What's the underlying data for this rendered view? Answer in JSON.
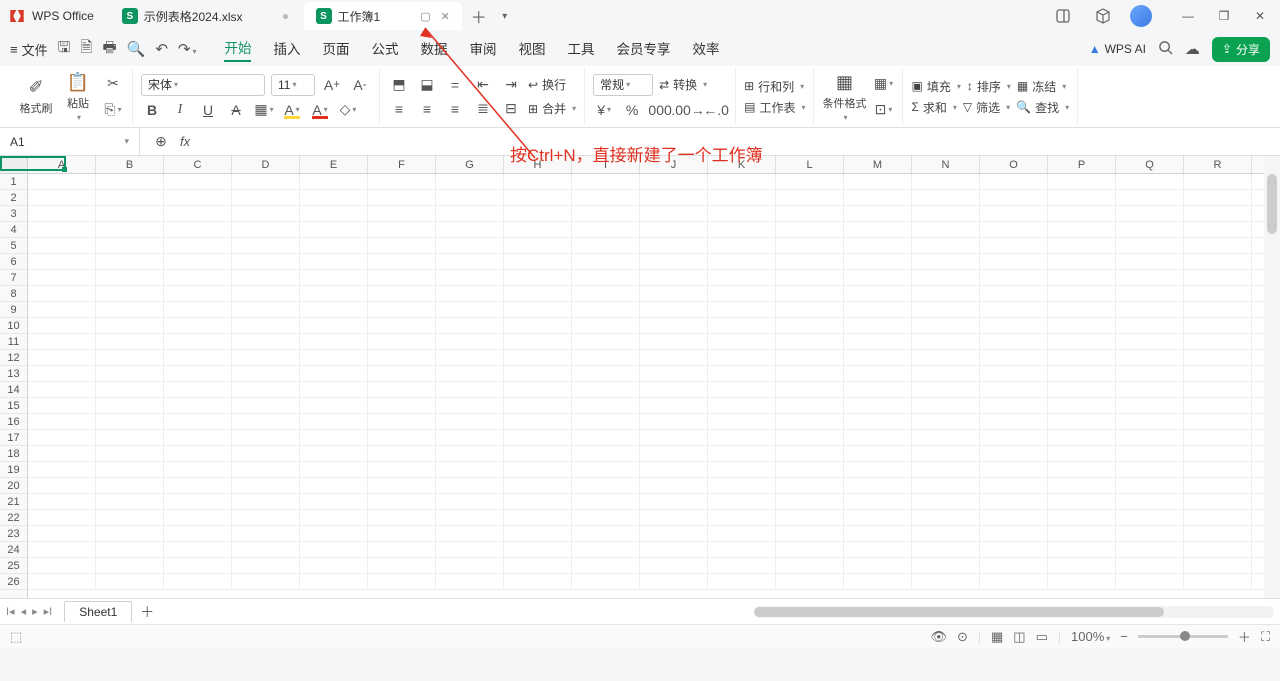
{
  "app": {
    "name": "WPS Office"
  },
  "tabs": [
    {
      "title": "示例表格2024.xlsx",
      "active": false
    },
    {
      "title": "工作簿1",
      "active": true
    }
  ],
  "menus": {
    "file": "文件",
    "items": [
      "开始",
      "插入",
      "页面",
      "公式",
      "数据",
      "审阅",
      "视图",
      "工具",
      "会员专享",
      "效率"
    ],
    "active": "开始"
  },
  "wps_ai": "WPS AI",
  "share_label": "分享",
  "ribbon": {
    "format_painter": "格式刷",
    "paste": "粘贴",
    "font_name": "宋体",
    "font_size": "11",
    "wrap": "换行",
    "number_format": "常规",
    "merge": "合并",
    "convert": "转换",
    "rowcol": "行和列",
    "worksheet": "工作表",
    "cond_fmt": "条件格式",
    "fill": "填充",
    "sum": "求和",
    "sort": "排序",
    "filter": "筛选",
    "freeze": "冻结",
    "find": "查找"
  },
  "name_box": "A1",
  "fx_label": "fx",
  "columns": [
    "A",
    "B",
    "C",
    "D",
    "E",
    "F",
    "G",
    "H",
    "I",
    "J",
    "K",
    "L",
    "M",
    "N",
    "O",
    "P",
    "Q",
    "R"
  ],
  "row_count": 26,
  "selected_cell": "A1",
  "annotation": "按Ctrl+N，直接新建了一个工作簿",
  "sheet": {
    "name": "Sheet1"
  },
  "status": {
    "zoom": "100%"
  }
}
